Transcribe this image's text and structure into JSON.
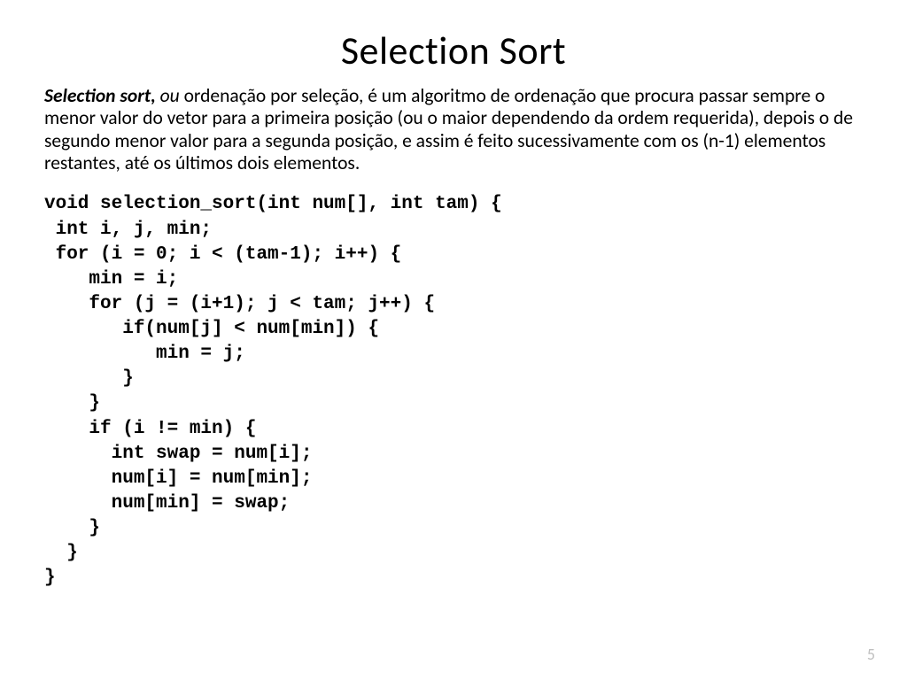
{
  "title": "Selection Sort",
  "description": {
    "lead_bi": "Selection sort,",
    "lead_it": " ou ",
    "body": "ordenação por seleção, é um algoritmo de ordenação que procura passar sempre o menor valor do vetor para a primeira posição (ou o maior dependendo da ordem requerida), depois o de segundo menor valor para a segunda posição, e assim é feito sucessivamente com os (n-1) elementos restantes, até os últimos dois elementos."
  },
  "code": "void selection_sort(int num[], int tam) {\n int i, j, min;\n for (i = 0; i < (tam-1); i++) {\n    min = i;\n    for (j = (i+1); j < tam; j++) {\n       if(num[j] < num[min]) {\n          min = j;\n       }\n    }\n    if (i != min) {\n      int swap = num[i];\n      num[i] = num[min];\n      num[min] = swap;\n    }\n  }\n}",
  "page_number": "5"
}
